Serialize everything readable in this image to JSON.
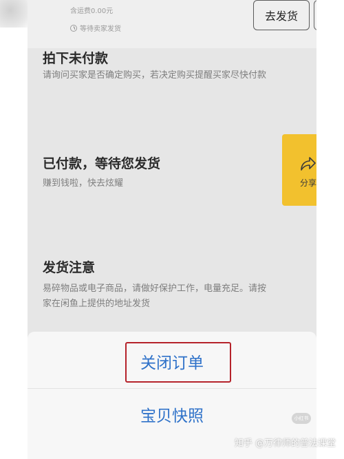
{
  "order": {
    "shipping_fee": "含运费0.00元",
    "waiting_label": "等待卖家发货",
    "ship_button_label": "去发货"
  },
  "cards": [
    {
      "title": "拍下未付款",
      "subtitle": "请询问买家是否确定购买，若决定购买提醒买家尽快付款"
    },
    {
      "title": "已付款，等待您发货",
      "subtitle": "赚到钱啦，快去炫耀"
    },
    {
      "title": "发货注意",
      "subtitle_line1": "易碎物品或电子商品，请做好保护工作，电量充足。请按",
      "subtitle_line2": "家在闲鱼上提供的地址发货"
    }
  ],
  "share": {
    "label": "分享"
  },
  "sheet": {
    "close_order_label": "关闭订单",
    "snapshot_label": "宝贝快照",
    "mini_badge": "小红书"
  },
  "watermark": "知乎 @万律师的普法课堂",
  "colors": {
    "action_blue": "#2f72c9",
    "highlight_red": "#b5222a",
    "share_yellow": "#f2c12e"
  }
}
